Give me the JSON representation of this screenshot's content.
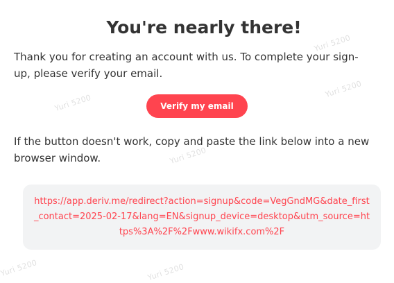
{
  "email": {
    "title": "You're nearly there!",
    "intro_text": "Thank you for creating an account with us. To complete your sign-up, please verify your email.",
    "verify_button_label": "Verify my email",
    "fallback_text": "If the button doesn't work, copy and paste the link below into a new browser window.",
    "link_url": "https://app.deriv.me/redirect?action=signup&code=VegGndMG&date_first_contact=2025-02-17&lang=EN&signup_device=desktop&utm_source=https%3A%2F%2Fwww.wikifx.com%2F"
  },
  "watermark": {
    "text": "Yuri 5200"
  },
  "colors": {
    "accent": "#ff444f",
    "text": "#333333",
    "link_box_bg": "#f2f3f4",
    "page_bg": "#ffffff"
  }
}
